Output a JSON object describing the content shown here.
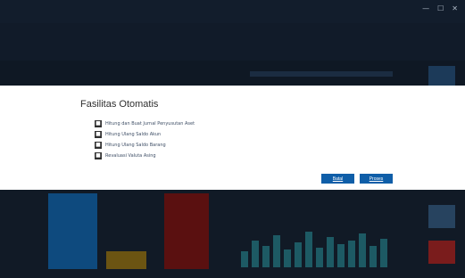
{
  "dialog": {
    "title": "Fasilitas Otomatis",
    "options": [
      {
        "label": "Hitung dan Buat Jurnal Penyusutan Aset",
        "checked": true
      },
      {
        "label": "Hitung Ulang Saldo Akun",
        "checked": true
      },
      {
        "label": "Hitung Ulang Saldo Barang",
        "checked": true
      },
      {
        "label": "Revaluasi Valuta Asing",
        "checked": true
      }
    ],
    "cancel_label": "Batal",
    "next_label": "Proses"
  },
  "colors": {
    "accent": "#0f5ea8",
    "overlay": "#0d1623",
    "dialog_bg": "#ffffff"
  }
}
